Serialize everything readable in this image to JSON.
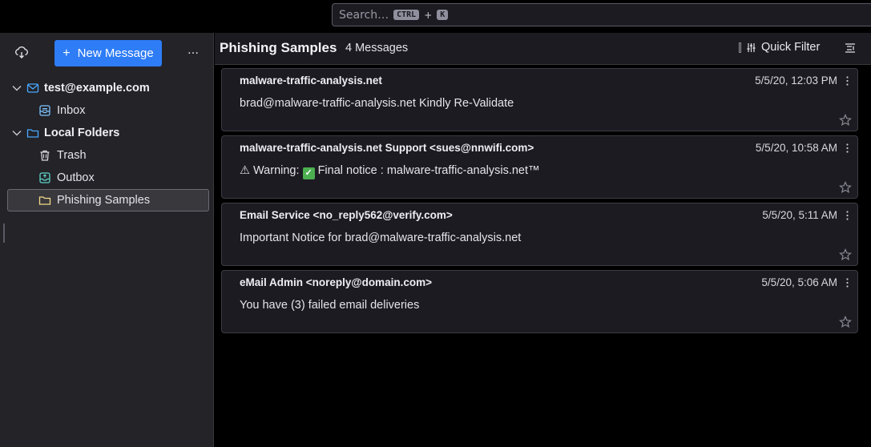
{
  "search": {
    "placeholder": "Search…",
    "kbd_ctrl": "CTRL",
    "kbd_plus": "+",
    "kbd_key": "K"
  },
  "folder_pane": {
    "new_message_label": "New Message",
    "new_message_plus": "+",
    "more_label": "…",
    "account": {
      "label": "test@example.com",
      "folders": [
        {
          "label": "Inbox"
        }
      ]
    },
    "local_folders": {
      "label": "Local Folders",
      "folders": [
        {
          "label": "Trash"
        },
        {
          "label": "Outbox"
        },
        {
          "label": "Phishing Samples",
          "selected": true
        }
      ]
    }
  },
  "thread_pane": {
    "title": "Phishing Samples",
    "count": "4 Messages",
    "quick_filter_label": "Quick Filter",
    "messages": [
      {
        "from": "malware-traffic-analysis.net",
        "date": "5/5/20, 12:03 PM",
        "subject": "brad@malware-traffic-analysis.net Kindly Re-Validate"
      },
      {
        "from": "malware-traffic-analysis.net Support <sues@nnwifi.com>",
        "date": "5/5/20, 10:58 AM",
        "subject_prefix": "⚠ Warning:",
        "subject_check": "✓",
        "subject_suffix": "Final notice : malware-traffic-analysis.net™"
      },
      {
        "from": "Email Service <no_reply562@verify.com>",
        "date": "5/5/20, 5:11 AM",
        "subject": "Important Notice for brad@malware-traffic-analysis.net"
      },
      {
        "from": "eMail Admin <noreply@domain.com>",
        "date": "5/5/20, 5:06 AM",
        "subject": "You have (3) failed email deliveries"
      }
    ]
  },
  "colors": {
    "accent": "#2e7cf6",
    "pane_bg": "#232328",
    "card_bg": "#1c1b22"
  }
}
